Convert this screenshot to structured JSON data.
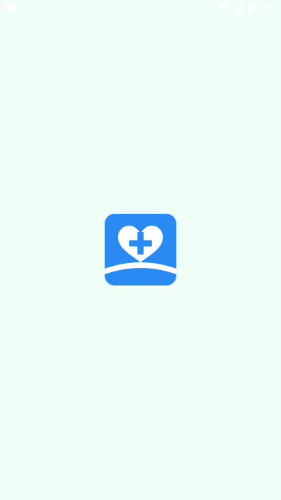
{
  "status_bar": {
    "time": "8:00",
    "icons": [
      "notification-icon",
      "wifi-icon",
      "signal-icon",
      "battery-icon"
    ]
  },
  "splash": {
    "logo_icon": "heart-medical-cross-icon",
    "colors": {
      "background": "#effff7",
      "logo_blue": "#2a8af3",
      "logo_white": "#ffffff"
    }
  }
}
